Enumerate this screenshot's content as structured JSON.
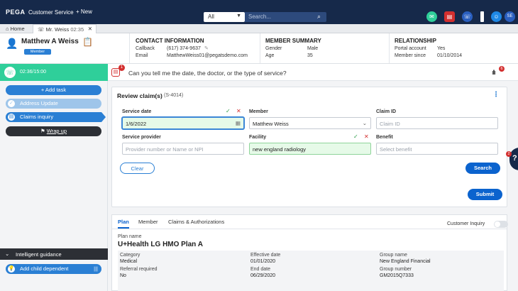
{
  "topbar": {
    "brand": "PEGA",
    "app_name": "Customer Service",
    "new_label": "+ New",
    "filter_value": "All",
    "search_placeholder": "Search...",
    "avatar_initials": "SE"
  },
  "tabs": {
    "home": "Home",
    "active": "Mr. Weiss",
    "active_time": "02:35"
  },
  "member": {
    "name": "Matthew A Weiss",
    "badge": "Member"
  },
  "contact": {
    "title": "CONTACT INFORMATION",
    "callback_label": "Callback",
    "callback_value": "(617) 374-9637",
    "email_label": "Email",
    "email_value": "MatthewWeiss01@pegatsdemo.com"
  },
  "summary": {
    "title": "MEMBER SUMMARY",
    "gender_label": "Gender",
    "gender_value": "Male",
    "age_label": "Age",
    "age_value": "35"
  },
  "relationship": {
    "title": "RELATIONSHIP",
    "portal_label": "Portal account",
    "portal_value": "Yes",
    "since_label": "Member since",
    "since_value": "01/10/2014"
  },
  "left": {
    "timer": "02:36/15:00",
    "add_task": "+ Add task",
    "tasks": [
      "Address Update",
      "Claims inquiry",
      "Wrap up"
    ],
    "guidance_title": "Intelligent guidance",
    "guidance_item": "Add child dependent"
  },
  "suggestion": {
    "badge": "1",
    "text": "Can you tell me the date, the doctor, or the type of service?",
    "wave_badge": "6"
  },
  "review": {
    "title": "Review claim(s)",
    "case_id": "(S-4014)",
    "service_date_label": "Service date",
    "service_date_value": "1/6/2022",
    "member_label": "Member",
    "member_value": "Matthew Weiss",
    "claim_id_label": "Claim ID",
    "claim_id_placeholder": "Claim ID",
    "provider_label": "Service provider",
    "provider_placeholder": "Provider number or Name or NPI",
    "facility_label": "Facility",
    "facility_value": "new england radiology",
    "benefit_label": "Benefit",
    "benefit_placeholder": "Select benefit",
    "clear": "Clear",
    "search": "Search",
    "submit": "Submit"
  },
  "help_badge": "2",
  "bottom": {
    "tabs": [
      "Plan",
      "Member",
      "Claims & Authorizations"
    ],
    "customer_inquiry": "Customer Inquiry",
    "plan_name_label": "Plan name",
    "plan_name": "U+Health LG HMO Plan A",
    "category_label": "Category",
    "category_value": "Medical",
    "referral_label": "Referral required",
    "referral_value": "No",
    "effective_label": "Effective date",
    "effective_value": "01/01/2020",
    "end_label": "End date",
    "end_value": "06/29/2020",
    "group_name_label": "Group name",
    "group_name_value": "New England Financial",
    "group_number_label": "Group number",
    "group_number_value": "GM2015Q7333"
  },
  "colors": {
    "navy": "#16294a",
    "accent_blue": "#0b63ce",
    "timer_green": "#2fcf9a",
    "task_done": "#9ec5ea",
    "task_active": "#2a7fd4",
    "task_dark": "#2c2f35"
  }
}
